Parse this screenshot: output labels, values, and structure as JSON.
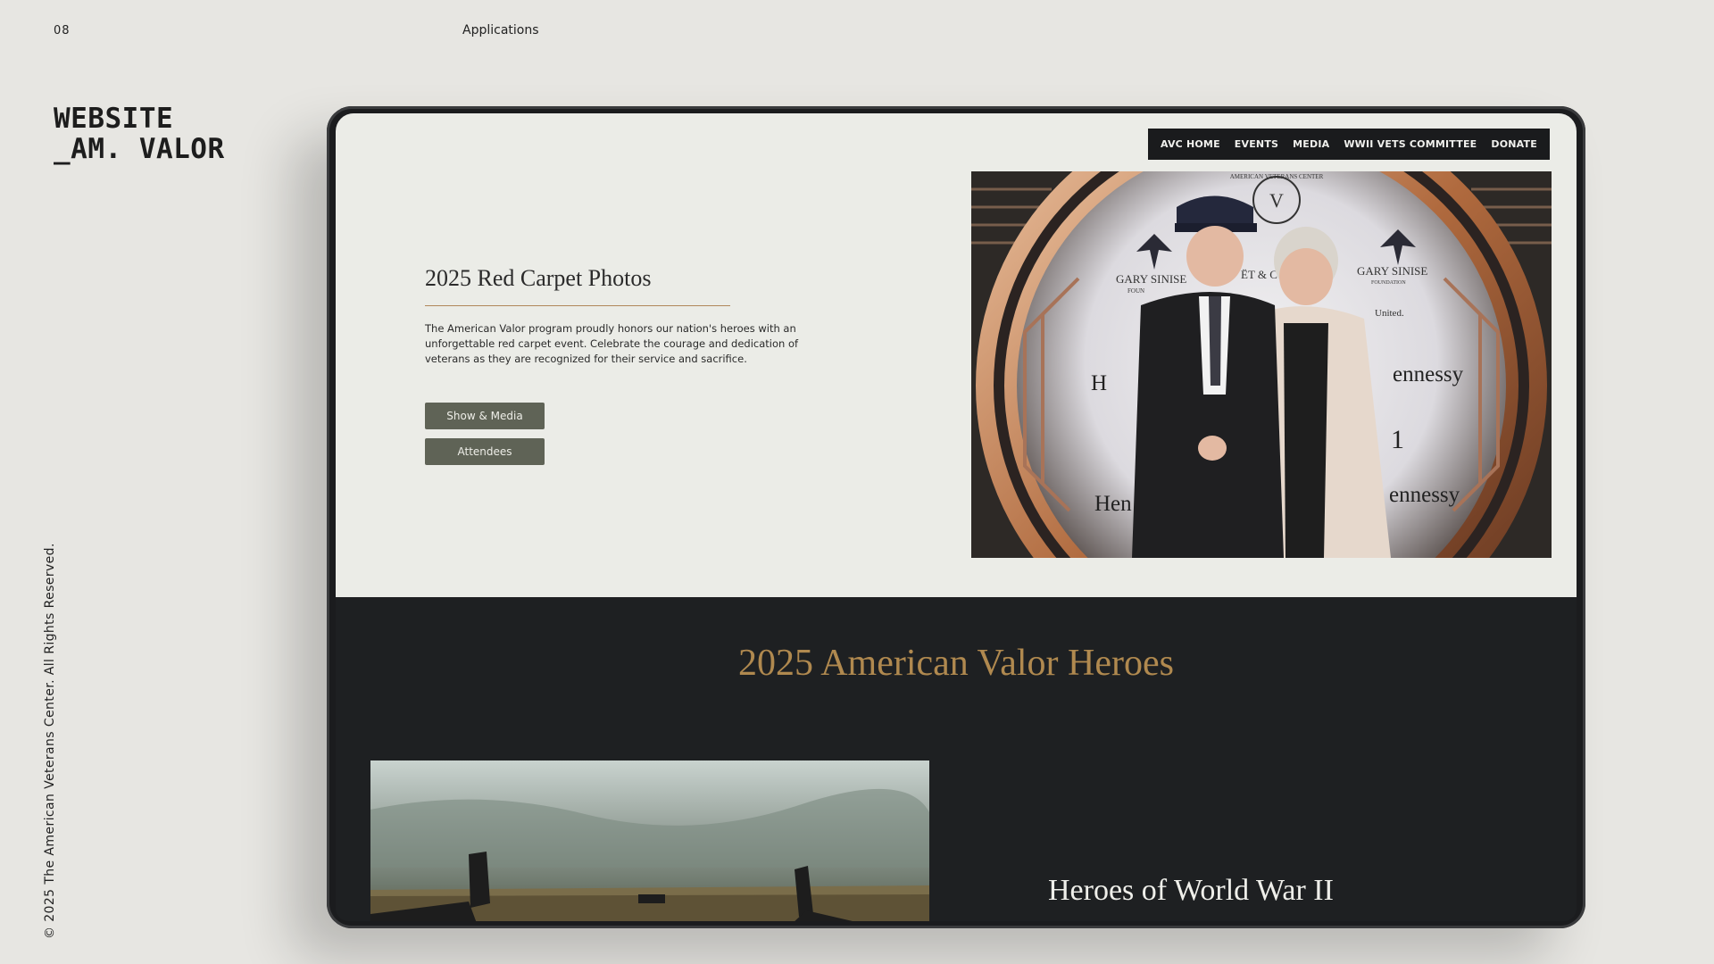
{
  "slide": {
    "page_number": "08",
    "section": "Applications",
    "brand_line1": "WEBSITE",
    "brand_line2": "_AM. VALOR",
    "copyright": "© 2025 The American Veterans Center. All Rights Reserved."
  },
  "site": {
    "nav": [
      "AVC HOME",
      "EVENTS",
      "MEDIA",
      "WWII VETS COMMITTEE",
      "DONATE"
    ],
    "hero": {
      "title": "2025 Red Carpet Photos",
      "body": "The American Valor program proudly honors our nation's heroes with an unforgettable red carpet event. Celebrate the courage and dedication of veterans as they are recognized for their service and sacrifice.",
      "buttons": [
        "Show & Media",
        "Attendees"
      ]
    },
    "photo_backdrop": {
      "seal_text": "AMERICAN VETERANS CENTER",
      "sponsor_left": "GARY SINISE",
      "sponsor_left_sub": "FOUN",
      "sponsor_right": "GARY SINISE",
      "sponsor_right_sub": "FOUNDATION",
      "moet": "ËT & C",
      "united": "United.",
      "hennessy_1": "ennessy",
      "hennessy_2": "ennessy",
      "h_left": "H",
      "hen_left": "Hen",
      "partial_1": "1"
    },
    "section_heading": "2025 American Valor Heroes",
    "subsection_heading": "Heroes of World War II"
  }
}
